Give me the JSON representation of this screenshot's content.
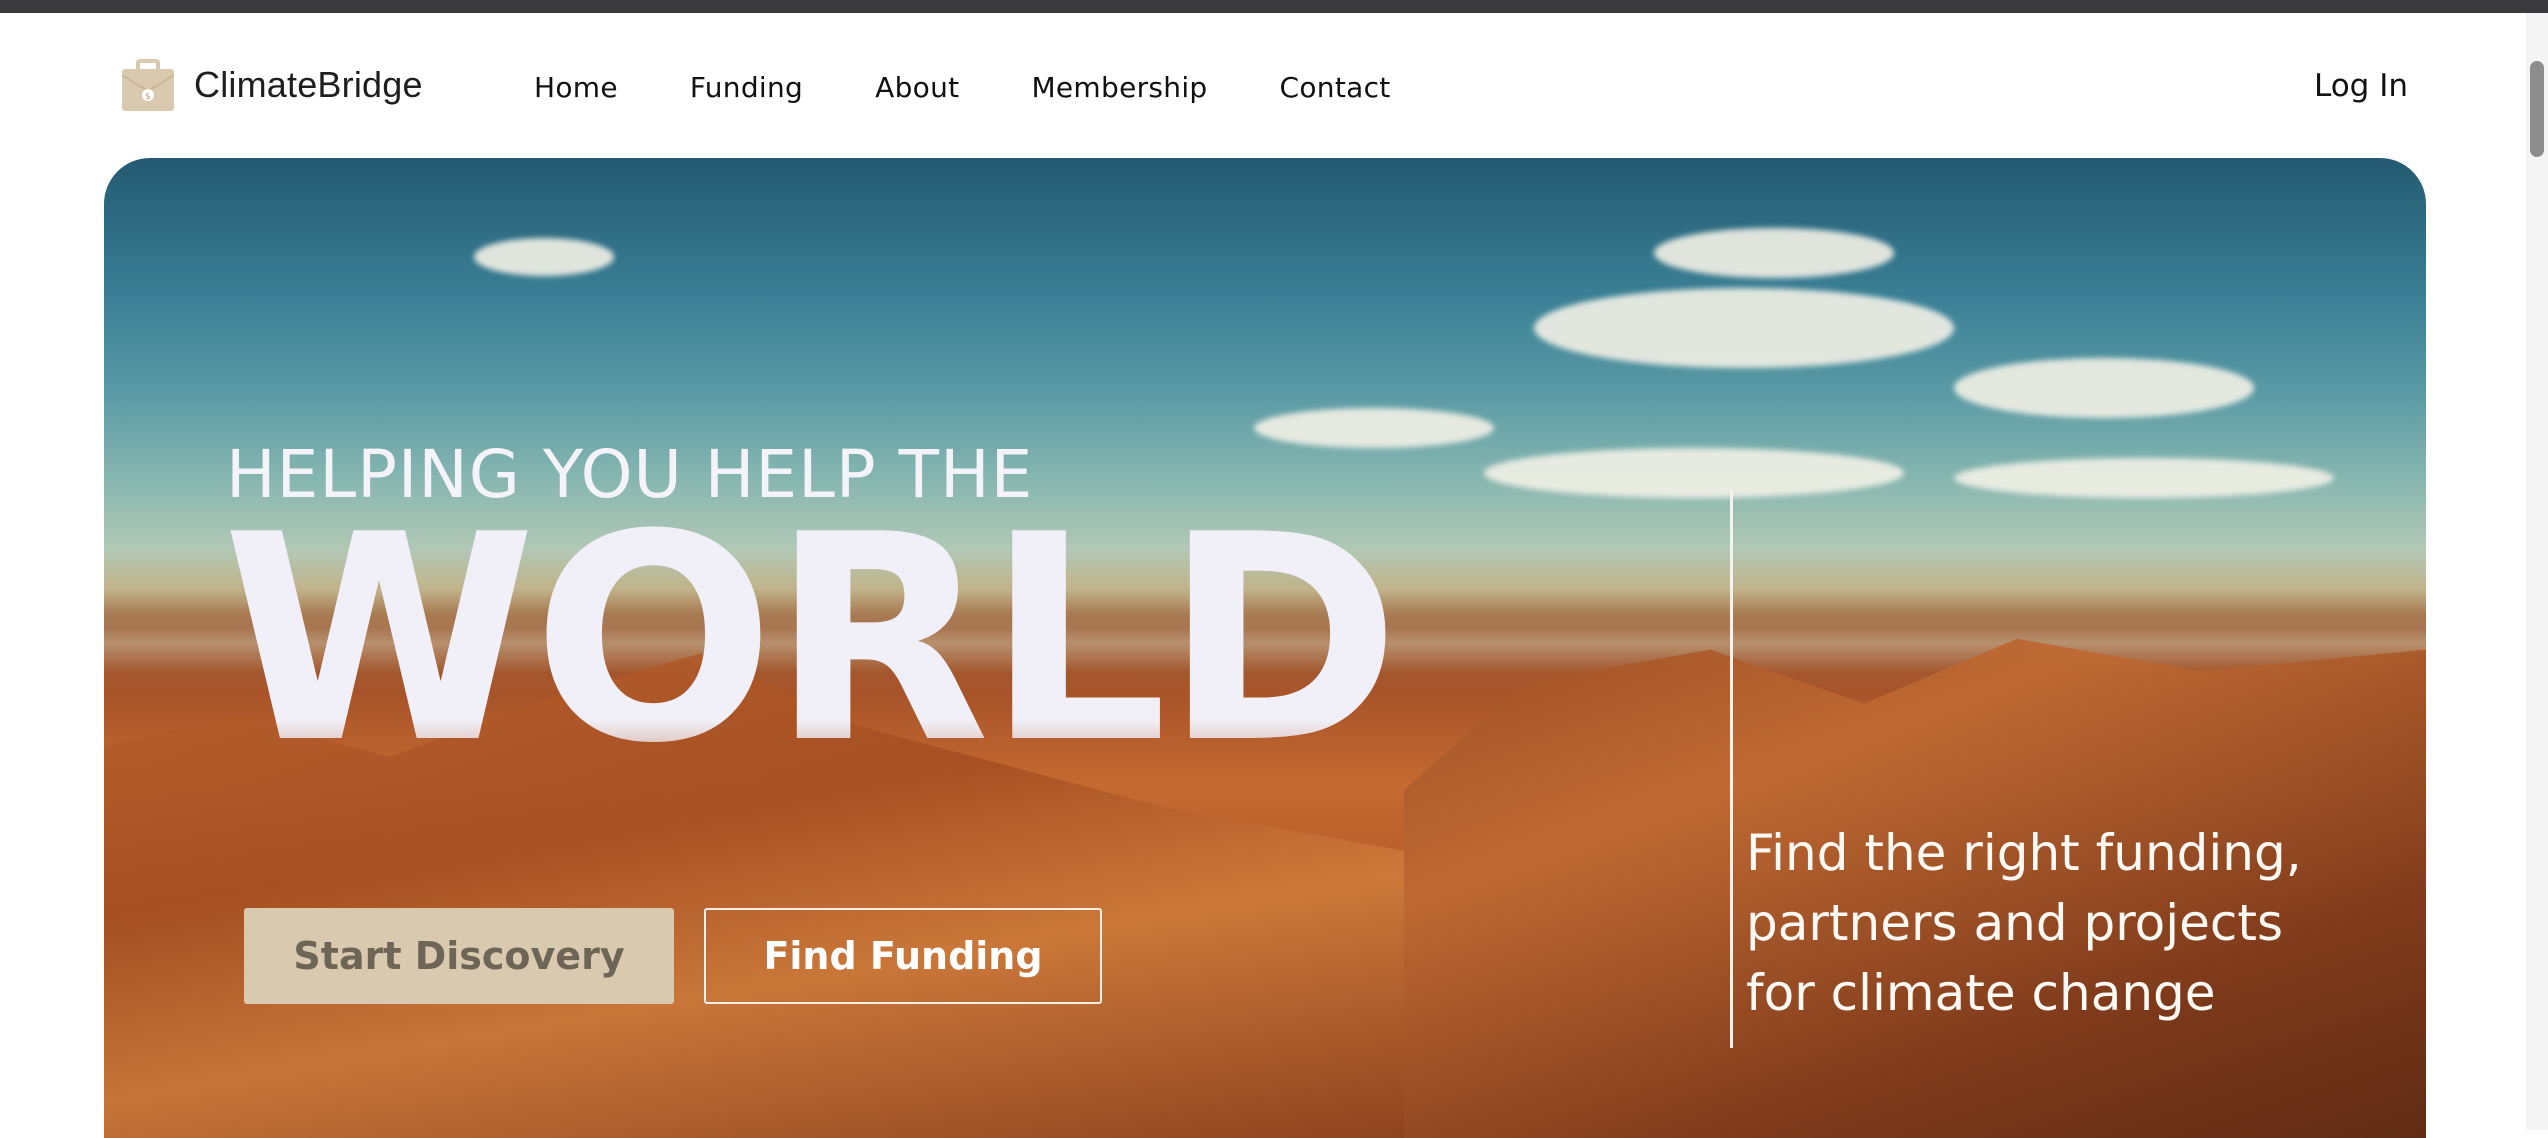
{
  "brand": {
    "name": "ClimateBridge",
    "logo_icon": "briefcase-dollar-icon",
    "logo_color": "#d8c9af"
  },
  "nav": {
    "items": [
      {
        "label": "Home"
      },
      {
        "label": "Funding"
      },
      {
        "label": "About"
      },
      {
        "label": "Membership"
      },
      {
        "label": "Contact"
      }
    ],
    "login_label": "Log In"
  },
  "hero": {
    "tagline": "HELPING YOU HELP THE",
    "headline": "WORLD",
    "primary_button": "Start Discovery",
    "secondary_button": "Find Funding",
    "side_text": "Find the right funding, partners and projects for climate change",
    "accent_color": "#d8c9af",
    "text_color": "#f1f0f8"
  }
}
